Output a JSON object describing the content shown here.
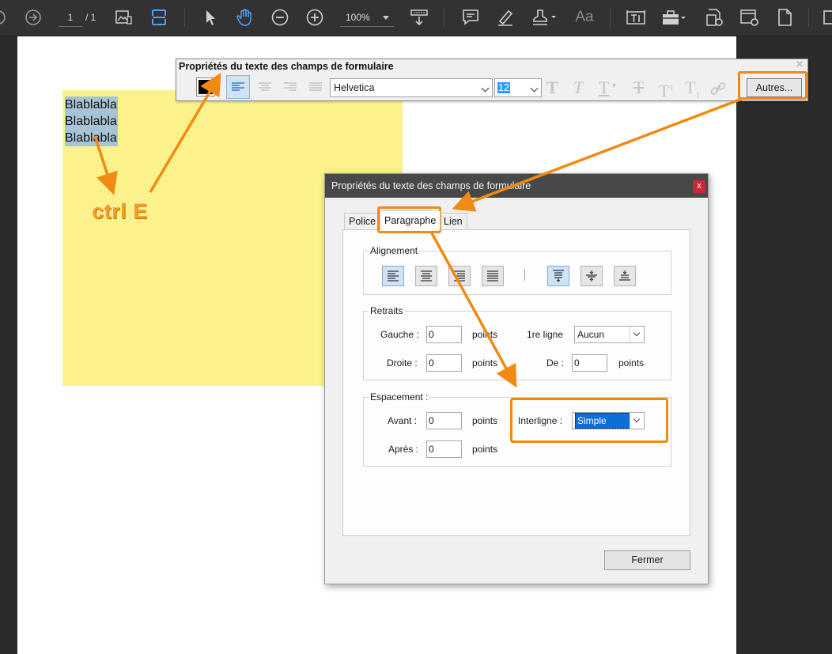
{
  "toolbar": {
    "page_current": "1",
    "page_total": "/ 1",
    "zoom": "100%",
    "icons": [
      "back-icon",
      "forward-icon",
      "thumbnails-icon",
      "fit-width-icon",
      "select-icon",
      "hand-icon",
      "zoom-out-icon",
      "zoom-in-icon",
      "download-icon",
      "comment-icon",
      "highlight-icon",
      "stamp-icon",
      "text-size-icon",
      "text-field-icon",
      "toolbox-icon",
      "form-settings-icon",
      "settings-icon",
      "document-icon"
    ]
  },
  "document": {
    "field_lines": [
      "Blablabla",
      "Blablabla",
      "Blablabla"
    ],
    "annotation_text": "ctrl E"
  },
  "props_bar": {
    "title": "Propriétés du texte des champs de formulaire",
    "font": "Helvetica",
    "size": "12",
    "more_button": "Autres...",
    "text_color": "#000000"
  },
  "dialog": {
    "title": "Propriétés du texte des champs de formulaire",
    "close": "x",
    "tabs": [
      "Police",
      "Paragraphe",
      "Lien"
    ],
    "active_tab": "Paragraphe",
    "alignment": {
      "label": "Alignement"
    },
    "indents": {
      "label": "Retraits",
      "left_label": "Gauche :",
      "left_value": "0",
      "right_label": "Droite :",
      "right_value": "0",
      "unit": "points",
      "first_line_label": "1re ligne",
      "first_line_value": "Aucun",
      "by_label": "De :",
      "by_value": "0"
    },
    "spacing": {
      "label": "Espacement :",
      "before_label": "Avant :",
      "before_value": "0",
      "after_label": "Après :",
      "after_value": "0",
      "unit": "points",
      "line_spacing_label": "Interligne :",
      "line_spacing_value": "Simple"
    },
    "close_button": "Fermer"
  },
  "colors": {
    "accent_orange": "#f08a13",
    "field_bg": "#fbf28b",
    "selection": "#a9c3d6"
  }
}
